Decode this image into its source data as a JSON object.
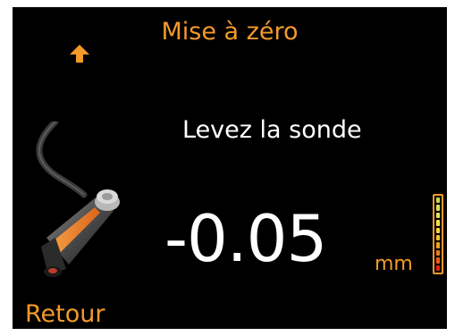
{
  "header": {
    "title": "Mise à zéro",
    "up_icon": "arrow-up-icon"
  },
  "message": "Levez la sonde",
  "measurement": {
    "value": "-0.05",
    "unit": "mm"
  },
  "level_indicator": {
    "segments": 10,
    "colors": [
      "#e82412",
      "#ef5b15",
      "#f07a1a",
      "#f2a11f",
      "#f4c22a",
      "#f4d339",
      "#f1e04a",
      "#e5e453",
      "#d5df54",
      "#c4d853"
    ]
  },
  "footer": {
    "back_label": "Retour"
  },
  "colors": {
    "accent": "#f39a2b",
    "background": "#000000",
    "text": "#ffffff"
  }
}
